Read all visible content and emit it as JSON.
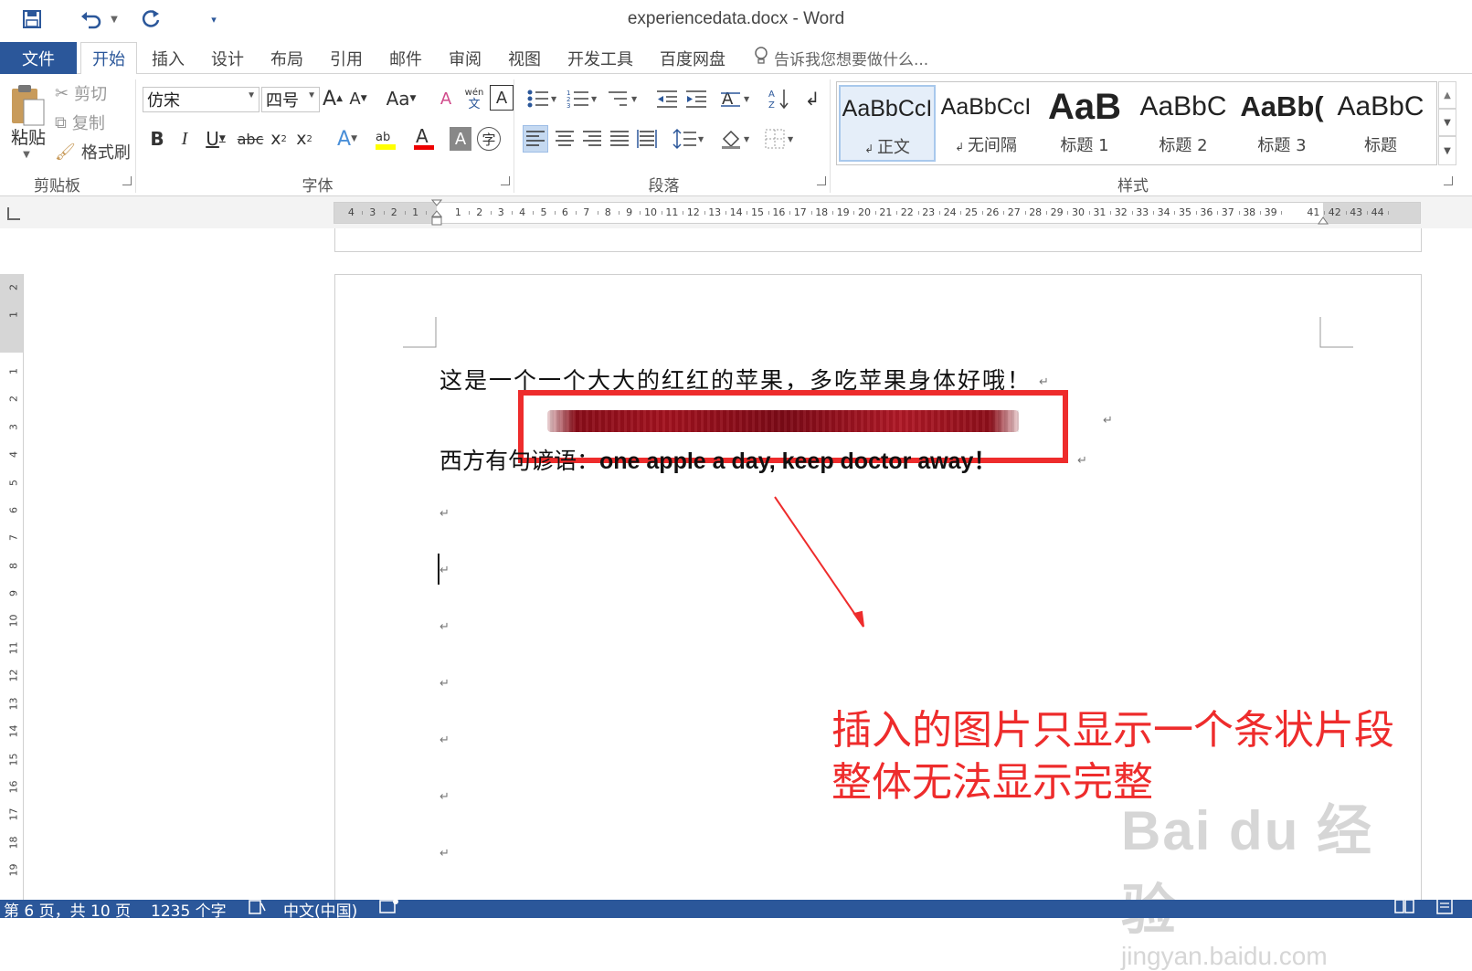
{
  "quick_access": {
    "save_icon": "save-icon",
    "undo_icon": "undo-icon",
    "redo_icon": "redo-icon",
    "customize_icon": "customize-qat-icon"
  },
  "window": {
    "title": "experiencedata.docx - Word"
  },
  "tabs": {
    "file": "文件",
    "items": [
      "开始",
      "插入",
      "设计",
      "布局",
      "引用",
      "邮件",
      "审阅",
      "视图",
      "开发工具",
      "百度网盘"
    ],
    "active": "开始",
    "tell_me": "告诉我您想要做什么..."
  },
  "ribbon": {
    "clipboard": {
      "label": "剪贴板",
      "paste": "粘贴",
      "cut": "剪切",
      "copy": "复制",
      "format_painter": "格式刷"
    },
    "font": {
      "label": "字体",
      "font_name": "仿宋",
      "font_size": "四号"
    },
    "paragraph": {
      "label": "段落"
    },
    "styles": {
      "label": "样式",
      "items": [
        {
          "preview": "AaBbCcI",
          "name": "正文"
        },
        {
          "preview": "AaBbCcI",
          "name": "无间隔"
        },
        {
          "preview": "AaB",
          "name": "标题 1"
        },
        {
          "preview": "AaBbC",
          "name": "标题 2"
        },
        {
          "preview": "AaBb(",
          "name": "标题 3"
        },
        {
          "preview": "AaBbC",
          "name": "标题"
        }
      ]
    }
  },
  "ruler": {
    "left_labels": [
      "4",
      "3",
      "2",
      "1"
    ],
    "labels": [
      "1",
      "2",
      "3",
      "4",
      "5",
      "6",
      "7",
      "8",
      "9",
      "10",
      "11",
      "12",
      "13",
      "14",
      "15",
      "16",
      "17",
      "18",
      "19",
      "20",
      "21",
      "22",
      "23",
      "24",
      "25",
      "26",
      "27",
      "28",
      "29",
      "30",
      "31",
      "32",
      "33",
      "34",
      "35",
      "36",
      "37",
      "38",
      "39"
    ],
    "right_labels": [
      "41",
      "42",
      "43",
      "44"
    ],
    "vertical_labels": [
      "2",
      "1",
      "1",
      "2",
      "3",
      "4",
      "5",
      "6",
      "7",
      "8",
      "9",
      "10",
      "11",
      "12",
      "13",
      "14",
      "15",
      "16",
      "17",
      "18",
      "19"
    ]
  },
  "document": {
    "line1": "这是一个一个大大的红红的苹果，多吃苹果身体好哦！",
    "line2_cn": "西方有句谚语：",
    "line2_en": "one apple a day, keep doctor away！",
    "para_mark": "↵"
  },
  "annotation": {
    "line1": "插入的图片只显示一个条状片段",
    "line2": "整体无法显示完整",
    "color": "#ee2c2c"
  },
  "watermark": {
    "brand": "Bai du 经验",
    "url": "jingyan.baidu.com"
  },
  "status": {
    "page": "第 6 页，共 10 页",
    "words": "1235 个字",
    "language": "中文(中国)"
  },
  "colors": {
    "accent": "#2b579a",
    "annotation_red": "#ee2c2c"
  }
}
